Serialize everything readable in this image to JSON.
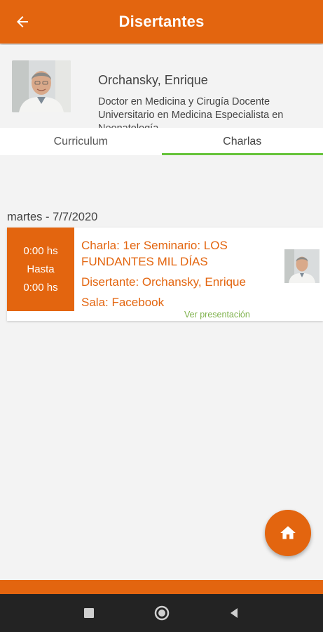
{
  "appbar": {
    "title": "Disertantes",
    "back_icon": "arrow-left-icon",
    "color": "#e3650f"
  },
  "speaker": {
    "name": "Orchansky, Enrique",
    "bio": "Doctor en Medicina y Cirugía Docente Universitario en Medicina Especialista en Neonatología"
  },
  "tabs": [
    {
      "label": "Curriculum",
      "active": false
    },
    {
      "label": "Charlas",
      "active": true
    }
  ],
  "tab_indicator_color": "#66c33a",
  "schedule": {
    "date": "martes - 7/7/2020",
    "talks": [
      {
        "start": "0:00 hs",
        "separator": "Hasta",
        "end": "0:00 hs",
        "title": "Charla: 1er Seminario: LOS FUNDANTES MIL DÍAS",
        "speaker": "Disertante: Orchansky, Enrique",
        "room": "Sala: Facebook",
        "link": "Ver presentación"
      }
    ]
  },
  "fab": {
    "icon": "home-icon"
  },
  "system_nav": {
    "recents_icon": "square-icon",
    "home_icon": "circle-icon",
    "back_icon": "triangle-back-icon"
  }
}
